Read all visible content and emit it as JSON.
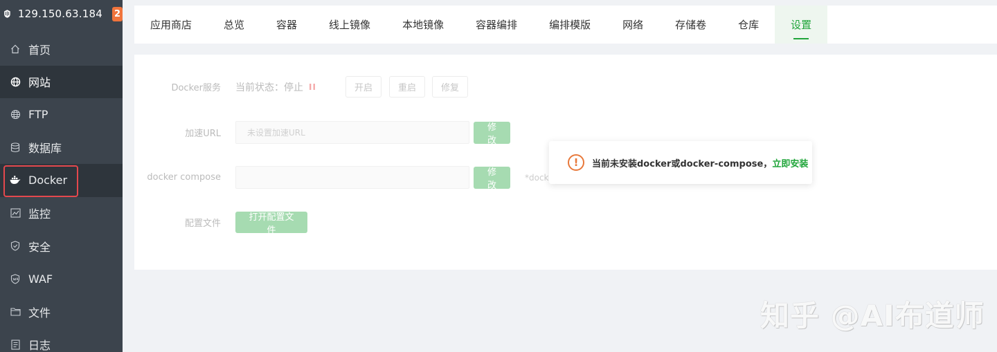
{
  "server": {
    "ip": "129.150.63.184",
    "badge_count": "2"
  },
  "sidebar": {
    "items": [
      {
        "label": "首页",
        "icon": "home-icon"
      },
      {
        "label": "网站",
        "icon": "globe-icon"
      },
      {
        "label": "FTP",
        "icon": "ftp-icon"
      },
      {
        "label": "数据库",
        "icon": "database-icon"
      },
      {
        "label": "Docker",
        "icon": "docker-icon"
      },
      {
        "label": "监控",
        "icon": "monitor-icon"
      },
      {
        "label": "安全",
        "icon": "shield-icon"
      },
      {
        "label": "WAF",
        "icon": "waf-icon"
      },
      {
        "label": "文件",
        "icon": "folder-icon"
      },
      {
        "label": "日志",
        "icon": "log-icon"
      }
    ]
  },
  "tabs": [
    {
      "label": "应用商店"
    },
    {
      "label": "总览"
    },
    {
      "label": "容器"
    },
    {
      "label": "线上镜像"
    },
    {
      "label": "本地镜像"
    },
    {
      "label": "容器编排"
    },
    {
      "label": "编排模版"
    },
    {
      "label": "网络"
    },
    {
      "label": "存储卷"
    },
    {
      "label": "仓库"
    },
    {
      "label": "设置"
    }
  ],
  "settings": {
    "docker_service": {
      "label": "Docker服务",
      "status": "当前状态：停止",
      "buttons": {
        "start": "开启",
        "restart": "重启",
        "repair": "修复"
      }
    },
    "mirror_url": {
      "label": "加速URL",
      "placeholder": "未设置加速URL",
      "button": "修改"
    },
    "docker_compose": {
      "label": "docker compose",
      "value": "",
      "button": "修改",
      "hint": "*dock"
    },
    "config_file": {
      "label": "配置文件",
      "button": "打开配置文件"
    }
  },
  "toast": {
    "message": "当前未安装docker或docker-compose，",
    "link": "立即安装"
  },
  "watermark": "知乎 @AI布道师",
  "colors": {
    "accent": "#20a53a",
    "sidebar_bg": "#3c444d",
    "warning": "#e8783a",
    "highlight_border": "#e5484d",
    "badge": "#f0743c"
  }
}
